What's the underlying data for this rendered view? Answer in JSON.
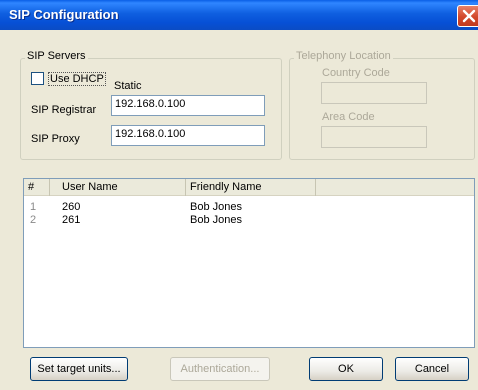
{
  "window": {
    "title": "SIP Configuration"
  },
  "sip_servers": {
    "legend": "SIP Servers",
    "use_dhcp_label": "Use DHCP",
    "use_dhcp_checked": false,
    "static_label": "Static",
    "registrar_label": "SIP Registrar",
    "registrar_value": "192.168.0.100",
    "proxy_label": "SIP Proxy",
    "proxy_value": "192.168.0.100"
  },
  "telephony": {
    "legend": "Telephony Location",
    "country_code_label": "Country Code",
    "country_code_value": "",
    "area_code_label": "Area Code",
    "area_code_value": ""
  },
  "users_list": {
    "columns": [
      "#",
      "User Name",
      "Friendly Name"
    ],
    "rows": [
      {
        "num": "1",
        "user": "260",
        "friendly": "Bob Jones"
      },
      {
        "num": "2",
        "user": "261",
        "friendly": "Bob Jones"
      }
    ]
  },
  "buttons": {
    "set_target": "Set target units...",
    "authentication": "Authentication...",
    "ok": "OK",
    "cancel": "Cancel"
  }
}
